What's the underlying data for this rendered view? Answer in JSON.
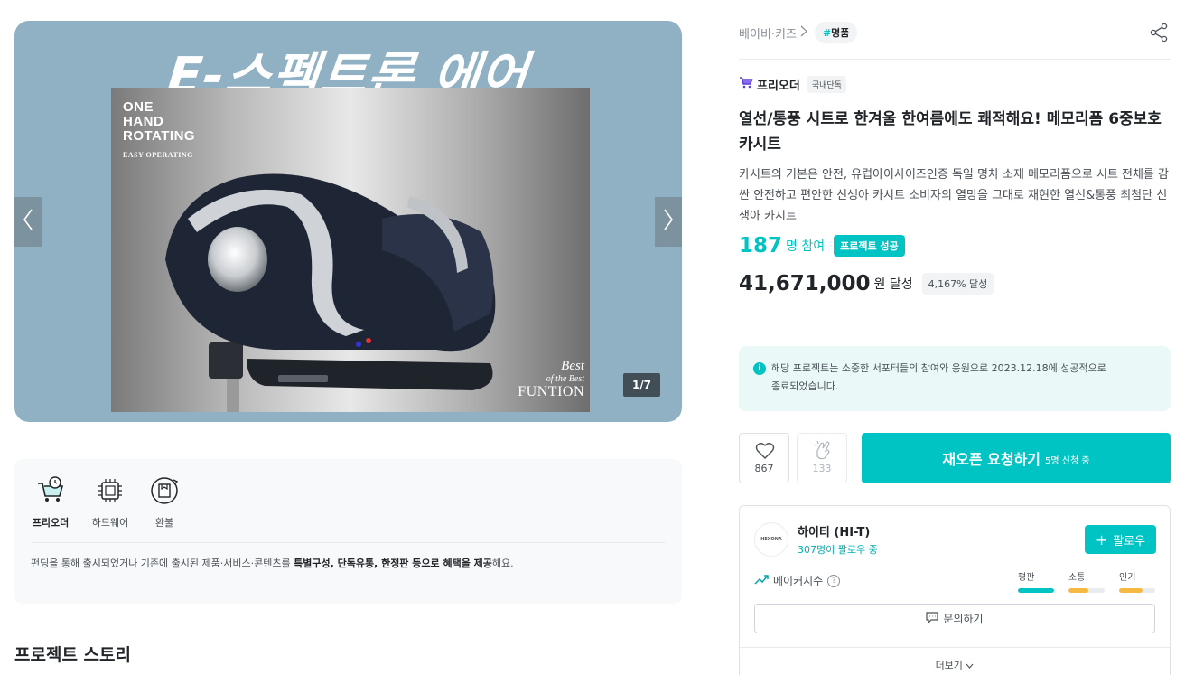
{
  "gallery": {
    "hero_title": "E-스펙트론 에어",
    "photo_text_main": "ONE\nHAND\nROTATING",
    "photo_text_sub": "EASY OPERATING",
    "best_1": "Best",
    "best_2": "of the Best",
    "best_3": "FUNTION",
    "counter": "1/7",
    "bg_color": "#90b1c4"
  },
  "benefits": {
    "items": [
      {
        "label": "프리오더",
        "icon": "cart-clock-icon"
      },
      {
        "label": "하드웨어",
        "icon": "chip-icon"
      },
      {
        "label": "환불",
        "icon": "refund-box-icon"
      }
    ],
    "desc_prefix": "펀딩을 통해 출시되었거나 기존에 출시된 제품·서비스·콘텐츠를 ",
    "desc_bold_1": "특별구성, 단독유통, 한정판 등으로 혜택을 제공",
    "desc_suffix": "해요."
  },
  "story_title": "프로젝트 스토리",
  "breadcrumb": {
    "category": "베이비·키즈",
    "tag_hash": "#",
    "tag": "명품"
  },
  "preorder": {
    "name": "프리오더",
    "badge": "국내단독"
  },
  "project": {
    "title": "열선/통풍 시트로 한겨울 한여름에도 쾌적해요! 메모리폼 6중보호 카시트",
    "subtitle": "카시트의 기본은 안전, 유럽아이사이즈인증 독일 명차 소재 메모리폼으로 시트 전체를 감싼 안전하고 편안한 신생아 카시트 소비자의 열망을 그대로 재현한 열선&통풍 최첨단 신생아 카시트",
    "participants": "187",
    "participants_unit": "명 참여",
    "success_badge": "프로젝트 성공",
    "amount": "41,671,000",
    "amount_unit": "원 달성",
    "achievement": "4,167% 달성"
  },
  "notice": {
    "icon": "i",
    "line1": "해당 프로젝트는 소중한 서포터들의 참여와 응원으로 2023.12.18에 성공적으로",
    "line2": "종료되었습니다."
  },
  "actions": {
    "likes": "867",
    "claps": "133",
    "reopen_label": "재오픈 요청하기",
    "reopen_sub": "5명 신청 중"
  },
  "maker": {
    "logo_text": "HEXONA",
    "name": "하이티 (HI-T)",
    "followers": "307명이 팔로우 중",
    "follow_label": "팔로우",
    "index_label": "메이커지수",
    "metrics": [
      {
        "label": "평판",
        "value": 1.0,
        "color": "#00c4c4"
      },
      {
        "label": "소통",
        "value": 0.55,
        "color": "#f5b942"
      },
      {
        "label": "인기",
        "value": 0.65,
        "color": "#f5b942"
      }
    ],
    "ask_label": "문의하기",
    "more_label": "더보기"
  },
  "colors": {
    "accent": "#00c4c4",
    "bar_warm": "#f5b942"
  }
}
